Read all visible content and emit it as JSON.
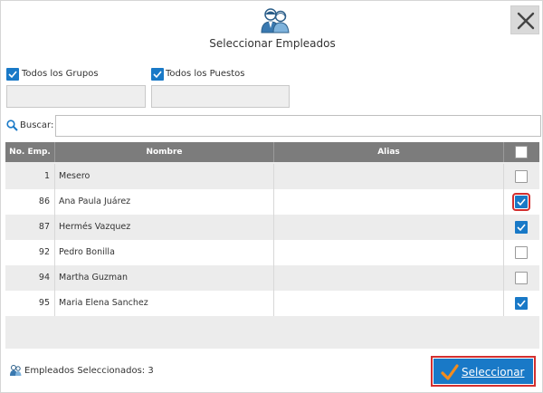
{
  "dialog": {
    "title": "Seleccionar Empleados",
    "close_icon": "close-x-icon",
    "header_icon": "employees-icon"
  },
  "filters": {
    "all_groups_label": "Todos los Grupos",
    "all_groups_checked": true,
    "all_positions_label": "Todos los Puestos",
    "all_positions_checked": true,
    "groups_value": "",
    "positions_value": ""
  },
  "search": {
    "icon": "search-icon",
    "label": "Buscar:",
    "value": ""
  },
  "table": {
    "columns": [
      "No. Emp.",
      "Nombre",
      "Alias"
    ],
    "select_all_checked": false,
    "rows": [
      {
        "num": "1",
        "name": "Mesero",
        "alias": "",
        "checked": false
      },
      {
        "num": "86",
        "name": "Ana Paula Juárez",
        "alias": "",
        "checked": true
      },
      {
        "num": "87",
        "name": "Hermés Vazquez",
        "alias": "",
        "checked": true
      },
      {
        "num": "92",
        "name": "Pedro Bonilla",
        "alias": "",
        "checked": false
      },
      {
        "num": "94",
        "name": "Martha Guzman",
        "alias": "",
        "checked": false
      },
      {
        "num": "95",
        "name": "Maria Elena Sanchez",
        "alias": "",
        "checked": true
      }
    ]
  },
  "footer": {
    "selected_label": "Empleados Seleccionados:",
    "selected_count": "3",
    "select_button_label": "Seleccionar",
    "select_button_icon": "checkmark-icon"
  },
  "colors": {
    "accent": "#1979c7",
    "highlight": "#d32f2f",
    "header_bg": "#7c7c7c",
    "checkmark": "#f28c1e"
  }
}
